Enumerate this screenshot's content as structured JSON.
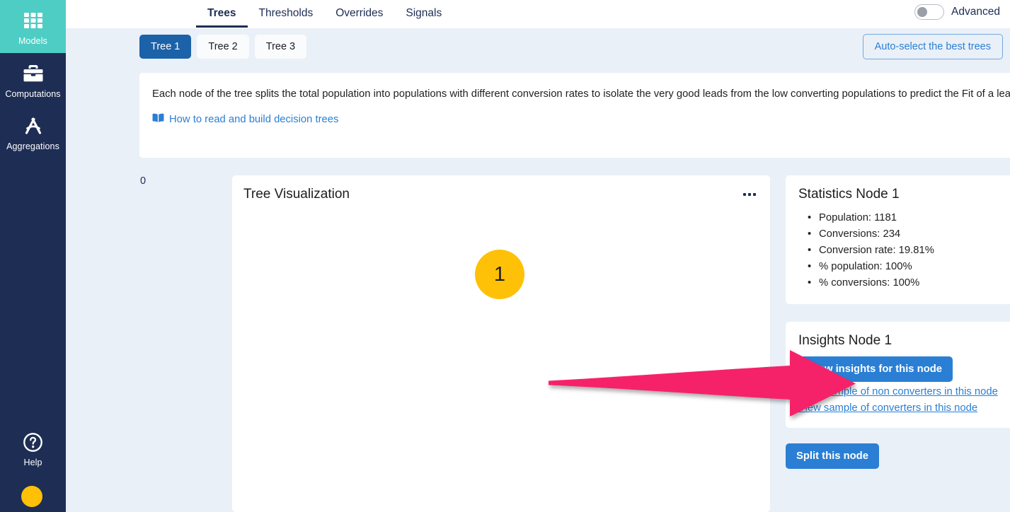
{
  "sidebar": {
    "items": [
      {
        "label": "Models",
        "icon": "grid-icon",
        "active": true
      },
      {
        "label": "Computations",
        "icon": "toolbox-icon",
        "active": false
      },
      {
        "label": "Aggregations",
        "icon": "compass-icon",
        "active": false
      }
    ],
    "help": {
      "label": "Help",
      "icon": "help-circle-icon"
    },
    "avatar": {
      "name": "user-avatar",
      "color": "#ffc107"
    }
  },
  "topbar": {
    "tabs": [
      {
        "label": "Trees",
        "active": true
      },
      {
        "label": "Thresholds",
        "active": false
      },
      {
        "label": "Overrides",
        "active": false
      },
      {
        "label": "Signals",
        "active": false
      }
    ],
    "advanced_label": "Advanced",
    "advanced_on": false
  },
  "treerow": {
    "tabs": [
      {
        "label": "Tree 1",
        "active": true
      },
      {
        "label": "Tree 2",
        "active": false
      },
      {
        "label": "Tree 3",
        "active": false
      }
    ],
    "autoselect_label": "Auto-select the best trees"
  },
  "description": {
    "text": "Each node of the tree splits the total population into populations with different conversion rates to isolate the very good leads from the low converting populations to predict the Fit of a lead.",
    "link_label": "How to read and build decision trees",
    "link_icon": "book-icon"
  },
  "canvas": {
    "zero_marker": "0"
  },
  "tree_panel": {
    "title": "Tree Visualization",
    "menu_icon": "ellipsis-icon",
    "root_node_label": "1"
  },
  "statistics": {
    "title": "Statistics Node 1",
    "items": [
      "Population: 1181",
      "Conversions: 234",
      "Conversion rate: 19.81%",
      "% population: 100%",
      "% conversions: 100%"
    ]
  },
  "insights": {
    "title": "Insights Node 1",
    "primary_button": "View insights for this node",
    "links": [
      "View sample of non converters in this node",
      "View sample of converters in this node"
    ]
  },
  "actions": {
    "split_label": "Split this node"
  },
  "annotation": {
    "arrow_color": "#f5246a",
    "arrow_direction": "right"
  },
  "colors": {
    "sidebar_bg": "#1e2d54",
    "sidebar_active": "#4ecdc4",
    "canvas_bg": "#eaf0f8",
    "primary_blue": "#2a7fd4",
    "tab_active_blue": "#1c62a8",
    "node_yellow": "#ffc107"
  }
}
